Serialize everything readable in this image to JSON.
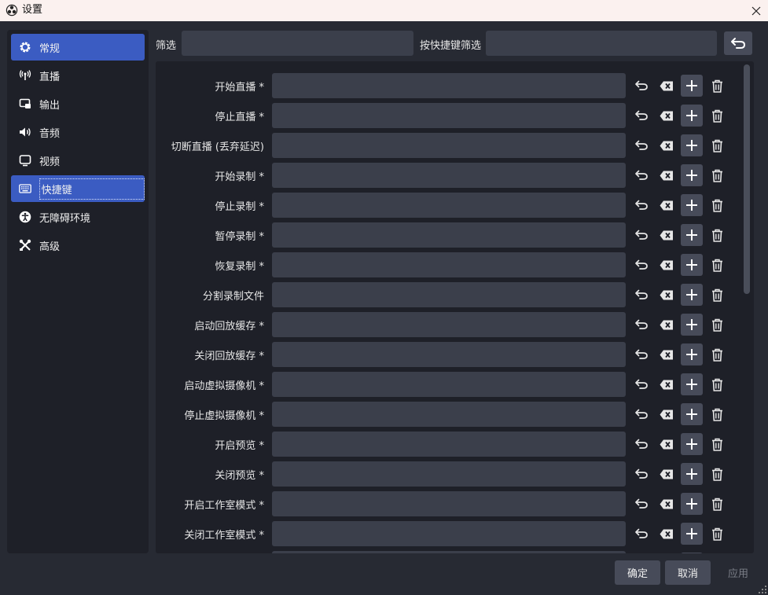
{
  "window": {
    "title": "设置",
    "app_icon": "obs-logo-icon",
    "close_icon": "close-icon"
  },
  "sidebar": {
    "items": [
      {
        "label": "常规",
        "icon": "gear-icon",
        "state": "selected"
      },
      {
        "label": "直播",
        "icon": "antenna-icon"
      },
      {
        "label": "输出",
        "icon": "output-icon"
      },
      {
        "label": "音频",
        "icon": "speaker-icon"
      },
      {
        "label": "视频",
        "icon": "monitor-icon"
      },
      {
        "label": "快捷键",
        "icon": "keyboard-icon",
        "state": "focused"
      },
      {
        "label": "无障碍环境",
        "icon": "accessibility-icon"
      },
      {
        "label": "高级",
        "icon": "tools-icon"
      }
    ]
  },
  "filters": {
    "filter_label": "筛选",
    "filter_value": "",
    "hotkey_filter_label": "按快捷键筛选",
    "hotkey_filter_value": "",
    "reset_icon": "undo-arrow-icon"
  },
  "hotkeys": [
    {
      "label": "开始直播 *",
      "value": ""
    },
    {
      "label": "停止直播 *",
      "value": ""
    },
    {
      "label": "切断直播 (丢弃延迟)",
      "value": ""
    },
    {
      "label": "开始录制 *",
      "value": ""
    },
    {
      "label": "停止录制 *",
      "value": ""
    },
    {
      "label": "暂停录制 *",
      "value": ""
    },
    {
      "label": "恢复录制 *",
      "value": ""
    },
    {
      "label": "分割录制文件",
      "value": ""
    },
    {
      "label": "启动回放缓存 *",
      "value": ""
    },
    {
      "label": "关闭回放缓存 *",
      "value": ""
    },
    {
      "label": "启动虚拟摄像机 *",
      "value": ""
    },
    {
      "label": "停止虚拟摄像机 *",
      "value": ""
    },
    {
      "label": "开启预览 *",
      "value": ""
    },
    {
      "label": "关闭预览 *",
      "value": ""
    },
    {
      "label": "开启工作室模式 *",
      "value": ""
    },
    {
      "label": "关闭工作室模式 *",
      "value": ""
    }
  ],
  "row_actions": {
    "revert_icon": "undo-icon",
    "clear_icon": "backspace-icon",
    "add_icon": "plus-icon",
    "remove_icon": "trash-icon"
  },
  "footer": {
    "ok": "确定",
    "cancel": "取消",
    "apply": "应用"
  },
  "colors": {
    "accent": "#3b5cc2",
    "panel": "#1e2028",
    "background": "#272a33",
    "input": "#3b3f4b"
  }
}
